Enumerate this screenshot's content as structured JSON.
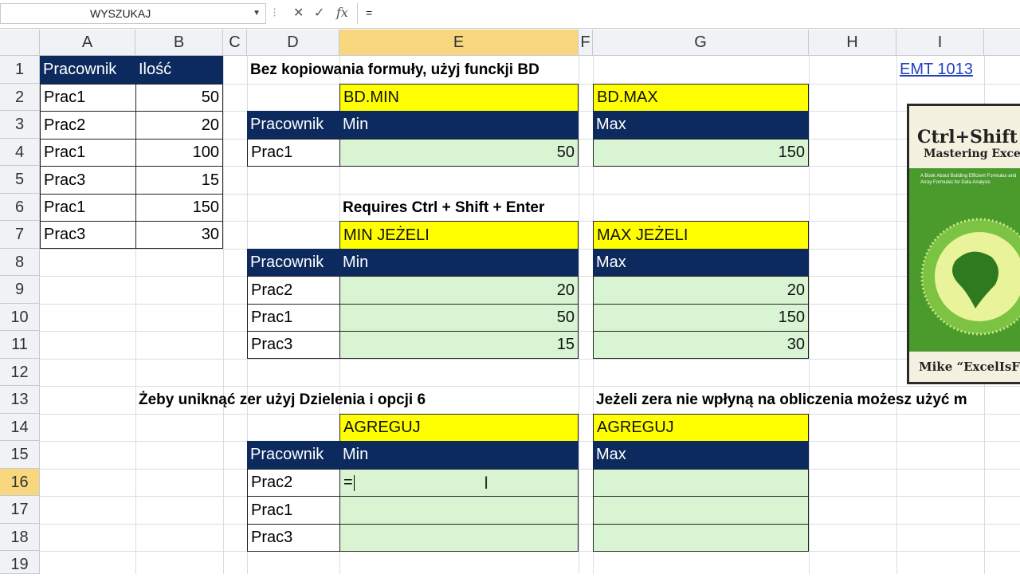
{
  "name_box": "WYSZUKAJ",
  "formula_bar": {
    "content": "="
  },
  "columns": [
    "A",
    "B",
    "C",
    "D",
    "E",
    "F",
    "G",
    "H",
    "I"
  ],
  "rows": [
    "1",
    "2",
    "3",
    "4",
    "5",
    "6",
    "7",
    "8",
    "9",
    "10",
    "11",
    "12",
    "13",
    "14",
    "15",
    "16",
    "17",
    "18",
    "19"
  ],
  "source_table": {
    "headers": [
      "Pracownik",
      "Ilość"
    ],
    "rows": [
      [
        "Prac1",
        "50"
      ],
      [
        "Prac2",
        "20"
      ],
      [
        "Prac1",
        "100"
      ],
      [
        "Prac3",
        "15"
      ],
      [
        "Prac1",
        "150"
      ],
      [
        "Prac3",
        "30"
      ]
    ]
  },
  "section1": {
    "title": "Bez kopiowania formuły, użyj funckji BD",
    "min_func": "BD.MIN",
    "max_func": "BD.MAX",
    "hdr_pracownik": "Pracownik",
    "hdr_min": "Min",
    "hdr_max": "Max",
    "row": {
      "name": "Prac1",
      "min": "50",
      "max": "150"
    }
  },
  "section2": {
    "title": "Requires Ctrl + Shift + Enter",
    "min_func": "MIN JEŻELI",
    "max_func": "MAX JEŻELI",
    "hdr_pracownik": "Pracownik",
    "hdr_min": "Min",
    "hdr_max": "Max",
    "rows": [
      {
        "name": "Prac2",
        "min": "20",
        "max": "20"
      },
      {
        "name": "Prac1",
        "min": "50",
        "max": "150"
      },
      {
        "name": "Prac3",
        "min": "15",
        "max": "30"
      }
    ]
  },
  "section3": {
    "title_left": "Żeby uniknąć zer użyj Dzielenia i opcji 6",
    "title_right": "Jeżeli zera nie wpłyną na obliczenia możesz użyć m",
    "min_func": "AGREGUJ",
    "max_func": "AGREGUJ",
    "hdr_pracownik": "Pracownik",
    "hdr_min": "Min",
    "hdr_max": "Max",
    "rows": [
      {
        "name": "Prac2",
        "min": "=",
        "max": ""
      },
      {
        "name": "Prac1",
        "min": "",
        "max": ""
      },
      {
        "name": "Prac3",
        "min": "",
        "max": ""
      }
    ]
  },
  "link": "EMT 1013",
  "book": {
    "title": "Ctrl+Shift",
    "subtitle": "Mastering Excel Ar",
    "tagline": "A Book About Building Efficient Formulas and Array Formulas for Data Analysis",
    "author": "Mike “ExcelIsF"
  },
  "colors": {
    "navy": "#0d2a5e",
    "yellow": "#ffff00",
    "green": "#d9f4d3",
    "selected_header": "#f9d77e"
  }
}
